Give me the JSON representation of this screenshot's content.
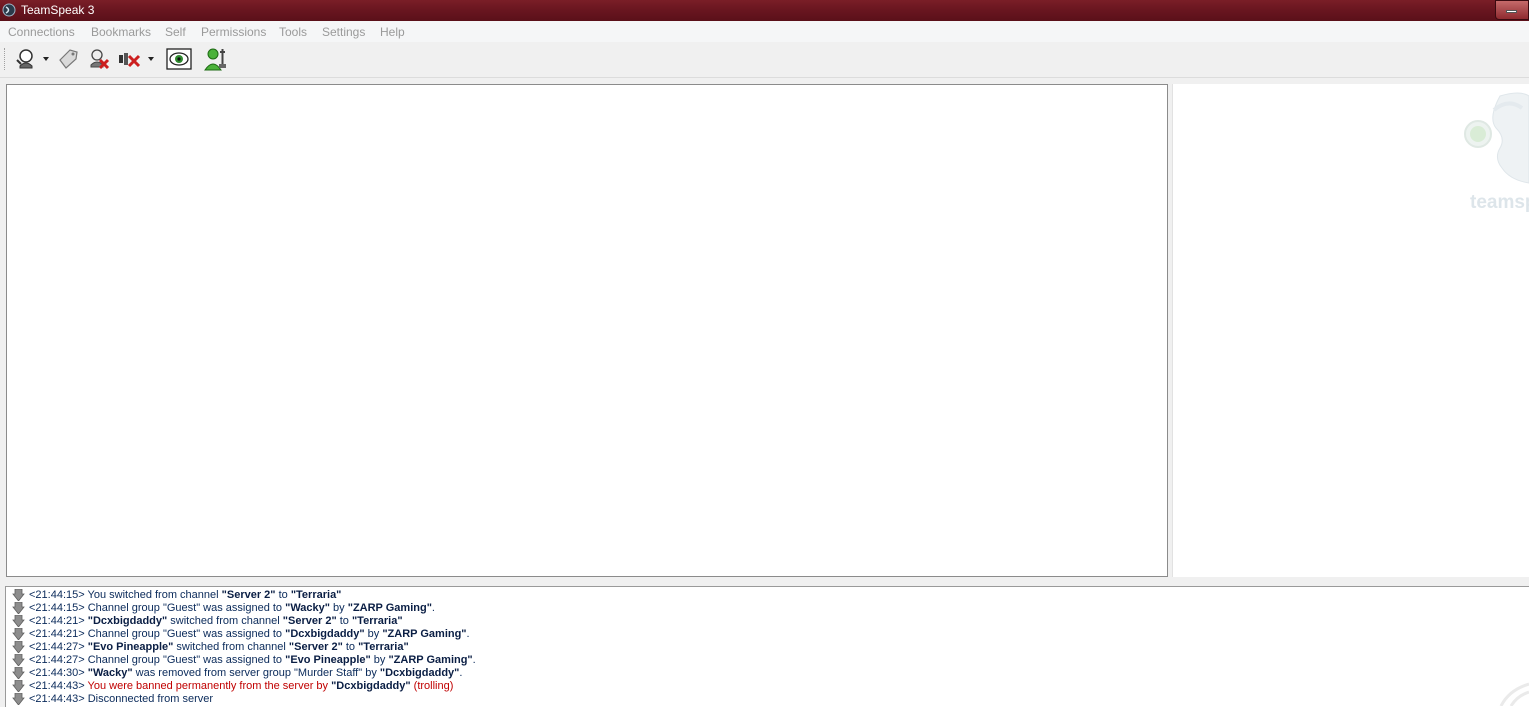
{
  "window": {
    "title": "TeamSpeak 3"
  },
  "menu": [
    "Connections",
    "Bookmarks",
    "Self",
    "Permissions",
    "Tools",
    "Settings",
    "Help"
  ],
  "logo": {
    "text": "teamspe"
  },
  "log": [
    {
      "time": "<21:44:15>",
      "parts": [
        " You switched from channel ",
        "\"Server 2\"",
        " to ",
        "\"Terraria\""
      ],
      "bold": [
        1,
        3
      ],
      "red": false
    },
    {
      "time": "<21:44:15>",
      "parts": [
        " Channel group \"Guest\" was assigned to ",
        "\"Wacky\"",
        " by ",
        "\"ZARP Gaming\"",
        "."
      ],
      "bold": [
        1,
        3
      ],
      "red": false
    },
    {
      "time": "<21:44:21>",
      "parts": [
        " ",
        "\"Dcxbigdaddy\"",
        " switched from channel ",
        "\"Server 2\"",
        " to ",
        "\"Terraria\""
      ],
      "bold": [
        1,
        3,
        5
      ],
      "red": false
    },
    {
      "time": "<21:44:21>",
      "parts": [
        " Channel group \"Guest\" was assigned to ",
        "\"Dcxbigdaddy\"",
        " by ",
        "\"ZARP Gaming\"",
        "."
      ],
      "bold": [
        1,
        3
      ],
      "red": false
    },
    {
      "time": "<21:44:27>",
      "parts": [
        " ",
        "\"Evo Pineapple\"",
        " switched from channel ",
        "\"Server 2\"",
        " to ",
        "\"Terraria\""
      ],
      "bold": [
        1,
        3,
        5
      ],
      "red": false
    },
    {
      "time": "<21:44:27>",
      "parts": [
        " Channel group \"Guest\" was assigned to ",
        "\"Evo Pineapple\"",
        " by ",
        "\"ZARP Gaming\"",
        "."
      ],
      "bold": [
        1,
        3
      ],
      "red": false
    },
    {
      "time": "<21:44:30>",
      "parts": [
        " ",
        "\"Wacky\"",
        " was removed from server group \"Murder Staff\" by ",
        "\"Dcxbigdaddy\"",
        "."
      ],
      "bold": [
        1,
        3
      ],
      "red": false
    },
    {
      "time": "<21:44:43>",
      "parts": [
        " You were banned permanently from the server by ",
        "\"Dcxbigdaddy\"",
        " (trolling)"
      ],
      "bold": [
        1
      ],
      "red": true
    },
    {
      "time": "<21:44:43>",
      "parts": [
        " Disconnected from server"
      ],
      "bold": [],
      "red": false
    }
  ]
}
